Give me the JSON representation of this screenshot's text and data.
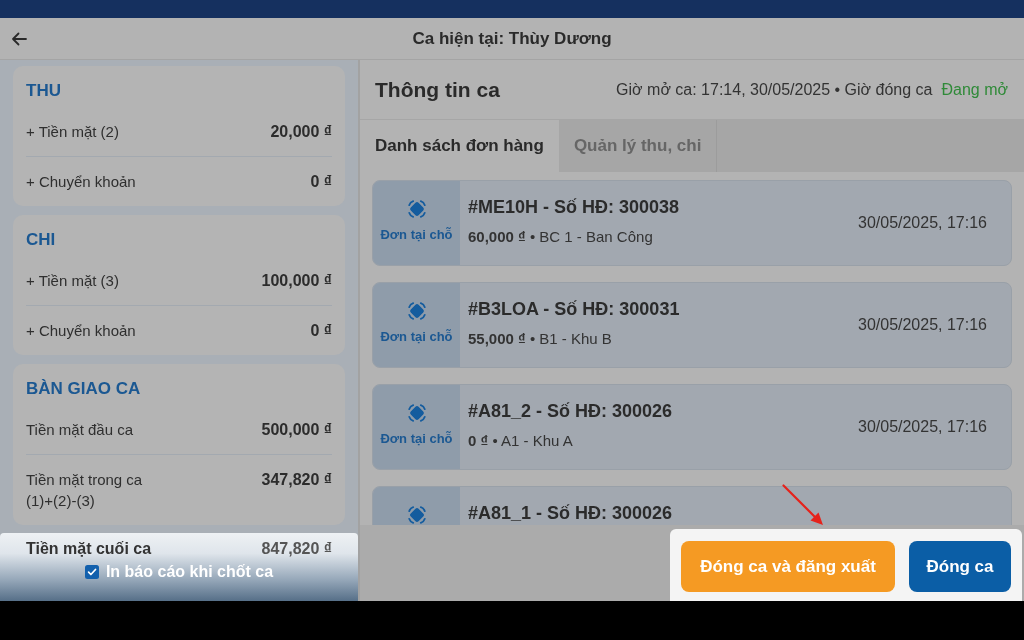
{
  "header": {
    "title": "Ca hiện tại: Thùy Dương"
  },
  "summary": {
    "sections": [
      {
        "title": "THU",
        "rows": [
          {
            "label": "+ Tiền mặt (2)",
            "value": "20,000 ₫"
          },
          {
            "label": "+ Chuyển khoản",
            "value": "0 ₫"
          }
        ]
      },
      {
        "title": "CHI",
        "rows": [
          {
            "label": "+ Tiền mặt (3)",
            "value": "100,000 ₫"
          },
          {
            "label": "+ Chuyển khoản",
            "value": "0 ₫"
          }
        ]
      },
      {
        "title": "BÀN GIAO CA",
        "rows": [
          {
            "label": "Tiền mặt đầu ca",
            "value": "500,000 ₫"
          },
          {
            "label": "Tiền mặt trong ca (1)+(2)-(3)",
            "value": "347,820 ₫"
          }
        ]
      }
    ],
    "closing_total": {
      "label": "Tiền mặt cuối ca",
      "value": "847,820 ₫"
    },
    "print_report": {
      "label": "In báo cáo khi chốt ca",
      "checked": true
    }
  },
  "shift_info": {
    "title": "Thông tin ca",
    "meta": "Giờ mở ca: 17:14, 30/05/2025 • Giờ đóng ca",
    "status": "Đang mở"
  },
  "tabs": [
    {
      "label": "Danh sách đơn hàng",
      "selected": true
    },
    {
      "label": "Quản lý thu, chi",
      "selected": false
    }
  ],
  "orders": [
    {
      "type_label": "Đơn tại chỗ",
      "title": "#ME10H - Số HĐ: 300038",
      "summary": "**60,000 ₫** • BC 1 - Ban Công",
      "time": "30/05/2025, 17:16"
    },
    {
      "type_label": "Đơn tại chỗ",
      "title": "#B3LOA - Số HĐ: 300031",
      "summary": "**55,000 ₫** • B1 - Khu B",
      "time": "30/05/2025, 17:16"
    },
    {
      "type_label": "Đơn tại chỗ",
      "title": "#A81_2 - Số HĐ: 300026",
      "summary": "**0 ₫** • A1 - Khu A",
      "time": "30/05/2025, 17:16"
    },
    {
      "title": "#A81_1 - Số HĐ: 300026"
    }
  ],
  "actions": [
    {
      "label": "Đóng ca và đăng xuất",
      "kind": "secondary"
    },
    {
      "label": "Đóng ca",
      "kind": "primary"
    }
  ]
}
